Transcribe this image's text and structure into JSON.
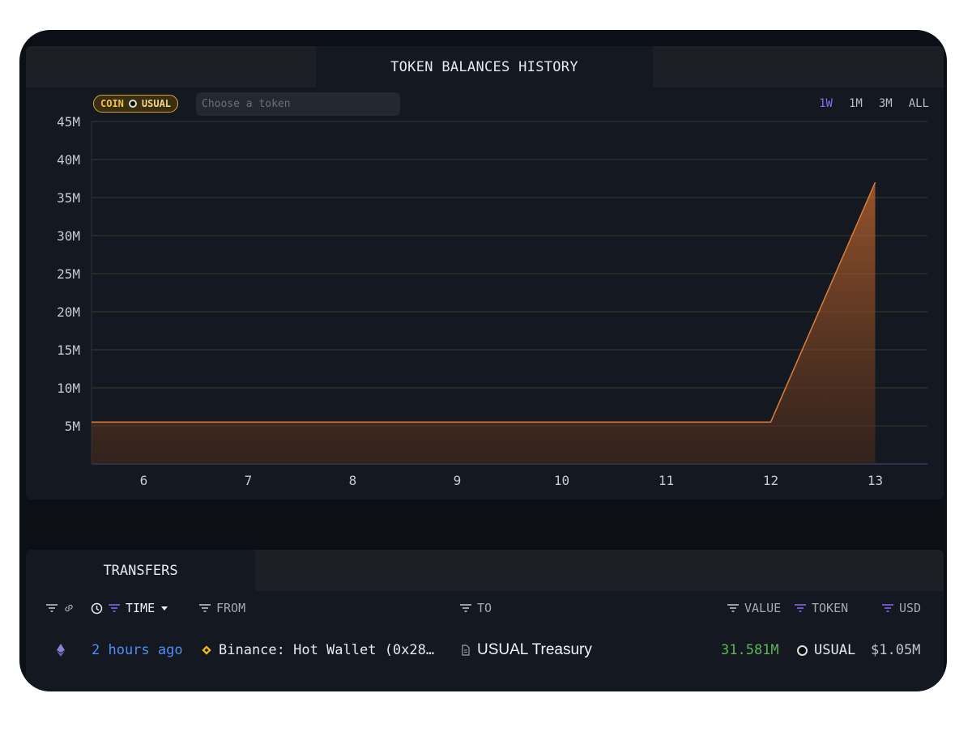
{
  "chart_panel": {
    "title": "TOKEN BALANCES HISTORY",
    "coin_label": "COIN",
    "coin_token": "USUAL",
    "search_placeholder": "Choose a token",
    "ranges": [
      "1W",
      "1M",
      "3M",
      "ALL"
    ],
    "active_range": "1W",
    "accent_color": "#8b6cf0"
  },
  "chart_data": {
    "type": "area",
    "x": [
      5.5,
      12,
      13
    ],
    "y": [
      5.5,
      5.5,
      37
    ],
    "x_ticks": [
      "6",
      "7",
      "8",
      "9",
      "10",
      "11",
      "12",
      "13"
    ],
    "y_ticks": [
      "5M",
      "10M",
      "15M",
      "20M",
      "25M",
      "30M",
      "35M",
      "40M",
      "45M"
    ],
    "ylim": [
      0,
      45
    ],
    "xlim": [
      5.5,
      13.5
    ],
    "grid": true,
    "color": "#d07a3c"
  },
  "transfers": {
    "tab_label": "TRANSFERS",
    "headers": {
      "time": "TIME",
      "from": "FROM",
      "to": "TO",
      "value": "VALUE",
      "token": "TOKEN",
      "usd": "USD"
    },
    "rows": [
      {
        "time": "2 hours ago",
        "from": "Binance: Hot Wallet (0x28…",
        "to": "USUAL Treasury",
        "value": "31.581M",
        "token": "USUAL",
        "usd": "$1.05M"
      }
    ]
  }
}
